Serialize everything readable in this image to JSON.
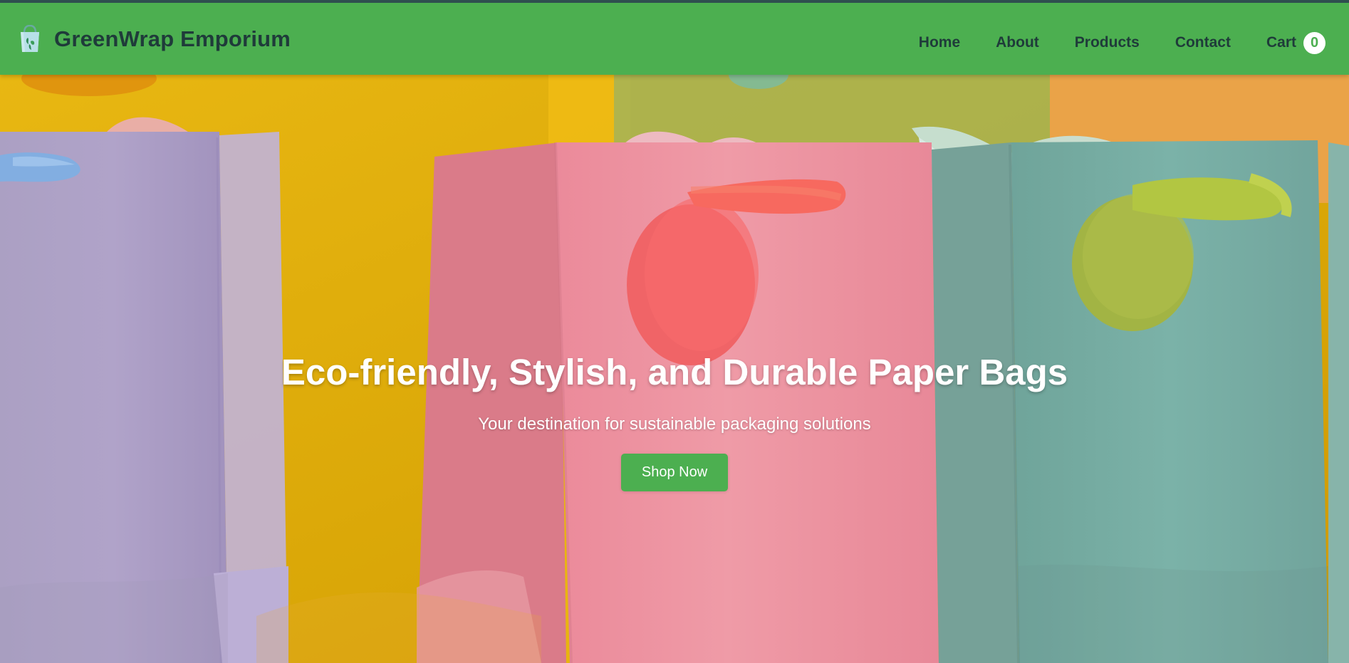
{
  "header": {
    "brand_name": "GreenWrap Emporium",
    "brand_icon": "shopping-bag-icon",
    "nav": [
      {
        "label": "Home"
      },
      {
        "label": "About"
      },
      {
        "label": "Products"
      },
      {
        "label": "Contact"
      },
      {
        "label": "Cart",
        "count": "0"
      }
    ]
  },
  "hero": {
    "title": "Eco-friendly, Stylish, and Durable Paper Bags",
    "subtitle": "Your destination for sustainable packaging solutions",
    "button_label": "Shop Now",
    "image": "colorful-paper-bags-photo"
  },
  "colors": {
    "header_background": "#4caf50",
    "top_border": "#2f4f4f",
    "text_dark": "#1f3b3a",
    "button": "#4caf50",
    "white": "#ffffff"
  }
}
